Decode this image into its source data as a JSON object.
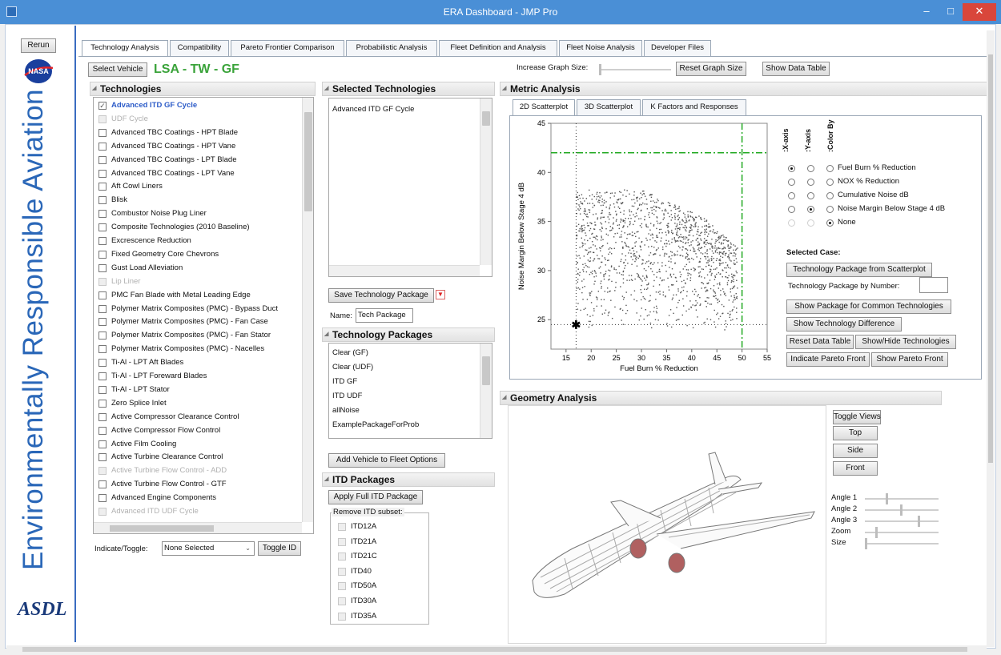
{
  "window": {
    "title": "ERA Dashboard - JMP Pro"
  },
  "sidebar": {
    "rerun_label": "Rerun",
    "nasa_logo_text": "NASA",
    "banner_text": "Environmentally Responsible Aviation",
    "asdl_logo_text": "ASDL"
  },
  "tabs": [
    "Technology Analysis",
    "Compatibility",
    "Pareto Frontier Comparison",
    "Probabilistic Analysis",
    "Fleet Definition and Analysis",
    "Fleet Noise Analysis",
    "Developer Files"
  ],
  "toolbar": {
    "select_vehicle_label": "Select Vehicle",
    "vehicle_name": "LSA - TW - GF",
    "increase_graph_label": "Increase Graph Size:",
    "reset_graph_label": "Reset Graph Size",
    "show_data_table_label": "Show Data Table"
  },
  "technologies": {
    "header": "Technologies",
    "items": [
      {
        "label": "Advanced ITD GF Cycle",
        "state": "checked"
      },
      {
        "label": "UDF Cycle",
        "state": "disabled"
      },
      {
        "label": "Advanced TBC Coatings - HPT Blade",
        "state": "normal"
      },
      {
        "label": "Advanced TBC Coatings - HPT Vane",
        "state": "normal"
      },
      {
        "label": "Advanced TBC Coatings - LPT Blade",
        "state": "normal"
      },
      {
        "label": "Advanced TBC Coatings - LPT Vane",
        "state": "normal"
      },
      {
        "label": "Aft Cowl Liners",
        "state": "normal"
      },
      {
        "label": "Blisk",
        "state": "normal"
      },
      {
        "label": "Combustor Noise Plug Liner",
        "state": "normal"
      },
      {
        "label": "Composite Technologies (2010 Baseline)",
        "state": "normal"
      },
      {
        "label": "Excrescence Reduction",
        "state": "normal"
      },
      {
        "label": "Fixed Geometry Core Chevrons",
        "state": "normal"
      },
      {
        "label": "Gust Load Alleviation",
        "state": "normal"
      },
      {
        "label": "Lip Liner",
        "state": "disabled"
      },
      {
        "label": "PMC Fan Blade with Metal Leading Edge",
        "state": "normal"
      },
      {
        "label": "Polymer Matrix Composites (PMC) - Bypass Duct",
        "state": "normal"
      },
      {
        "label": "Polymer Matrix Composites (PMC) - Fan Case",
        "state": "normal"
      },
      {
        "label": "Polymer Matrix Composites (PMC) - Fan Stator",
        "state": "normal"
      },
      {
        "label": "Polymer Matrix Composites (PMC) - Nacelles",
        "state": "normal"
      },
      {
        "label": "Ti-Al - LPT Aft Blades",
        "state": "normal"
      },
      {
        "label": "Ti-Al - LPT Foreward Blades",
        "state": "normal"
      },
      {
        "label": "Ti-Al - LPT Stator",
        "state": "normal"
      },
      {
        "label": "Zero Splice Inlet",
        "state": "normal"
      },
      {
        "label": "Active Compressor Clearance Control",
        "state": "normal"
      },
      {
        "label": "Active Compressor Flow Control",
        "state": "normal"
      },
      {
        "label": "Active Film Cooling",
        "state": "normal"
      },
      {
        "label": "Active Turbine Clearance Control",
        "state": "normal"
      },
      {
        "label": "Active Turbine Flow Control - ADD",
        "state": "disabled"
      },
      {
        "label": "Active Turbine Flow Control - GTF",
        "state": "normal"
      },
      {
        "label": "Advanced Engine Components",
        "state": "normal"
      },
      {
        "label": "Advanced ITD UDF Cycle",
        "state": "disabled"
      }
    ],
    "indicate_label": "Indicate/Toggle:",
    "indicate_value": "None Selected",
    "toggle_id_label": "Toggle ID"
  },
  "selected_technologies": {
    "header": "Selected Technologies",
    "items": [
      "Advanced ITD GF Cycle"
    ],
    "save_label": "Save Technology Package",
    "name_label": "Name:",
    "name_value": "Tech Package"
  },
  "technology_packages": {
    "header": "Technology Packages",
    "items": [
      "Clear (GF)",
      "Clear (UDF)",
      "ITD GF",
      "ITD UDF",
      "allNoise",
      "ExamplePackageForProb"
    ],
    "add_vehicle_label": "Add Vehicle to Fleet Options"
  },
  "itd_packages": {
    "header": "ITD Packages",
    "apply_label": "Apply Full ITD Package",
    "remove_label": "Remove ITD subset:",
    "items": [
      "ITD12A",
      "ITD21A",
      "ITD21C",
      "ITD40",
      "ITD50A",
      "ITD30A",
      "ITD35A"
    ]
  },
  "metric_analysis": {
    "header": "Metric Analysis",
    "tabs": [
      "2D Scatterplot",
      "3D Scatterplot",
      "K Factors and Responses"
    ],
    "axis_headers": [
      ":X-axis",
      ":Y-axis",
      ":Color By"
    ],
    "metrics": [
      {
        "label": "Fuel Burn % Reduction",
        "x": true,
        "y": false,
        "c": false
      },
      {
        "label": "NOX % Reduction",
        "x": false,
        "y": false,
        "c": false
      },
      {
        "label": "Cumulative Noise dB",
        "x": false,
        "y": false,
        "c": false
      },
      {
        "label": "Noise Margin Below Stage 4 dB",
        "x": false,
        "y": true,
        "c": false
      },
      {
        "label": "None",
        "x": false,
        "y": false,
        "c": true
      }
    ],
    "selected_case_label": "Selected Case:",
    "tech_from_scatter_label": "Technology Package from Scatterplot",
    "tech_by_number_label": "Technology Package by Number:",
    "show_common_label": "Show Package for Common Technologies",
    "show_difference_label": "Show Technology Difference",
    "reset_table_label": "Reset Data Table",
    "show_hide_label": "Show/Hide Technologies",
    "indicate_pareto_label": "Indicate Pareto Front",
    "show_pareto_label": "Show Pareto Front"
  },
  "chart_data": {
    "type": "scatter",
    "xlabel": "Fuel Burn % Reduction",
    "ylabel": "Noise Margin Below Stage 4 dB",
    "xlim": [
      12,
      55
    ],
    "ylim": [
      22,
      45
    ],
    "xticks": [
      15,
      20,
      25,
      30,
      35,
      40,
      45,
      50,
      55
    ],
    "yticks": [
      25,
      30,
      35,
      40,
      45
    ],
    "selected_point": {
      "x": 17,
      "y": 24.5
    },
    "reference_lines": {
      "x_dotted": 17,
      "y_dotted": 24.5,
      "x_dashdot": 50,
      "y_dashdot": 42
    },
    "cloud": {
      "x_range": [
        17,
        49
      ],
      "y_range": [
        24,
        38.5
      ]
    },
    "colors": {
      "points": "#555555",
      "dashdot": "#22aa22",
      "dotted": "#333333"
    }
  },
  "geometry_analysis": {
    "header": "Geometry Analysis",
    "toggle_views_label": "Toggle Views",
    "views": [
      "Top",
      "Side",
      "Front"
    ],
    "sliders": [
      {
        "label": "Angle 1",
        "value": 0.3
      },
      {
        "label": "Angle 2",
        "value": 0.5
      },
      {
        "label": "Angle 3",
        "value": 0.75
      },
      {
        "label": "Zoom",
        "value": 0.15
      },
      {
        "label": "Size",
        "value": 0.0
      }
    ]
  }
}
